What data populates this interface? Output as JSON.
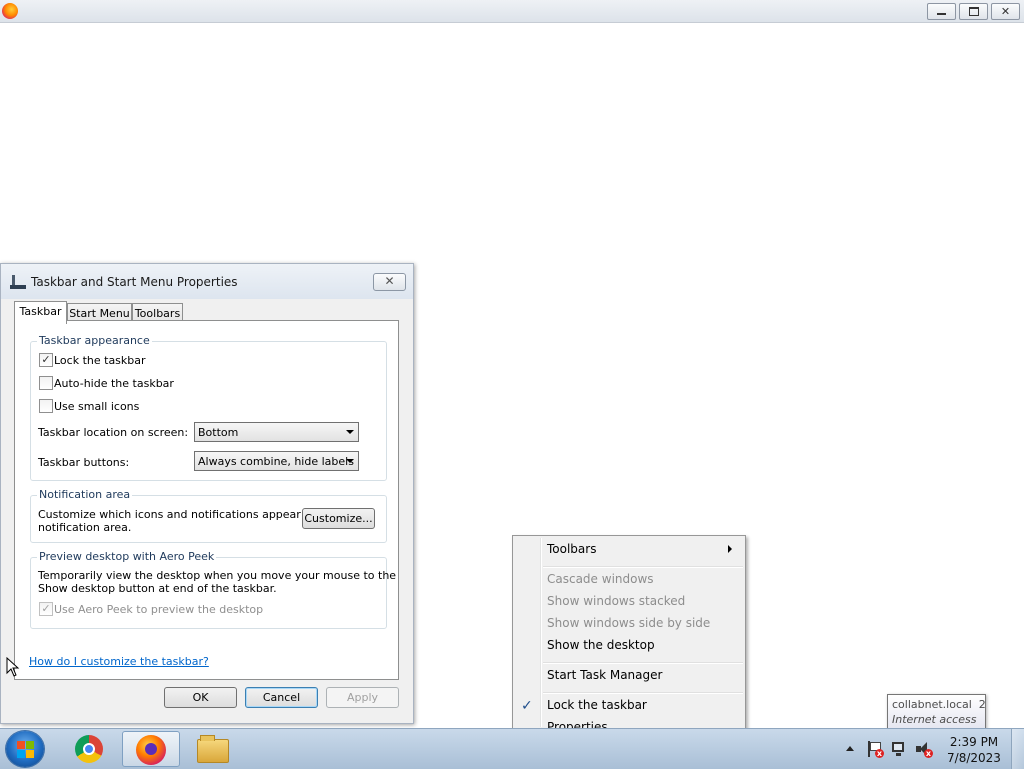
{
  "browser_window": {
    "icon": "firefox-icon",
    "controls": [
      "minimize-icon",
      "restore-icon",
      "close-icon"
    ]
  },
  "dialog": {
    "title": "Taskbar and Start Menu Properties",
    "close_symbol": "✕",
    "tabs": [
      {
        "label": "Taskbar",
        "active": true
      },
      {
        "label": "Start Menu",
        "active": false
      },
      {
        "label": "Toolbars",
        "active": false
      }
    ],
    "appearance": {
      "legend": "Taskbar appearance",
      "lock_label": "Lock the taskbar",
      "lock_checked": true,
      "autohide_label": "Auto-hide the taskbar",
      "autohide_checked": false,
      "small_icons_label": "Use small icons",
      "small_icons_checked": false,
      "location_label": "Taskbar location on screen:",
      "location_value": "Bottom",
      "buttons_label": "Taskbar buttons:",
      "buttons_value": "Always combine, hide labels"
    },
    "notification": {
      "legend": "Notification area",
      "text_line1": "Customize which icons and notifications appear in the",
      "text_line2": "notification area.",
      "customize_button": "Customize..."
    },
    "aero": {
      "legend": "Preview desktop with Aero Peek",
      "text_line1": "Temporarily view the desktop when you move your mouse to the",
      "text_line2": "Show desktop button at end of the taskbar.",
      "use_label": "Use Aero Peek to preview the desktop",
      "use_checked": true,
      "use_disabled": true
    },
    "help_link": "How do I customize the taskbar?",
    "ok_button": "OK",
    "cancel_button": "Cancel",
    "apply_button": "Apply",
    "check_mark": "✓"
  },
  "context_menu": {
    "items": [
      {
        "label": "Toolbars",
        "disabled": false,
        "submenu": true
      },
      {
        "label": "Cascade windows",
        "disabled": true
      },
      {
        "label": "Show windows stacked",
        "disabled": true
      },
      {
        "label": "Show windows side by side",
        "disabled": true
      },
      {
        "label": "Show the desktop",
        "disabled": false
      },
      {
        "label": "Start Task Manager",
        "disabled": false
      },
      {
        "label": "Lock the taskbar",
        "disabled": false,
        "checked": true
      },
      {
        "label": "Properties",
        "disabled": false
      }
    ],
    "check_mark": "✓"
  },
  "tooltip": {
    "line1": "collabnet.local  2",
    "line2": "Internet access"
  },
  "taskbar": {
    "pinned": [
      "windows-start-icon",
      "chrome-icon",
      "firefox-icon",
      "file-explorer-icon"
    ],
    "active_app": "firefox-icon",
    "clock_time": "2:39 PM",
    "clock_date": "7/8/2023",
    "tray_icons": [
      "show-hidden-icons-icon",
      "action-center-flag-icon",
      "network-icon",
      "volume-muted-icon"
    ],
    "tray_error_mark": "x"
  }
}
